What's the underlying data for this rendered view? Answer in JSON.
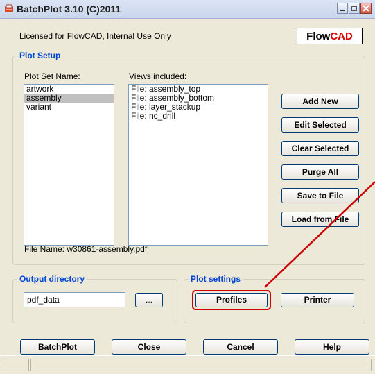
{
  "window": {
    "title": "BatchPlot 3.10 (C)2011"
  },
  "license_text": "Licensed for FlowCAD, Internal Use Only",
  "logo": {
    "part1": "Flow",
    "part2": "CAD",
    "accent": "#e10000"
  },
  "plot_setup": {
    "group_label": "Plot Setup",
    "plot_set_label": "Plot Set Name:",
    "views_label": "Views included:",
    "plot_sets": [
      "artwork",
      "assembly",
      "variant"
    ],
    "selected_plot_set": "assembly",
    "views": [
      "File: assembly_top",
      "File: assembly_bottom",
      "File: layer_stackup",
      "File: nc_drill"
    ],
    "buttons": {
      "add_new": "Add New",
      "edit_selected": "Edit Selected",
      "clear_selected": "Clear Selected",
      "purge_all": "Purge All",
      "save_to_file": "Save to File",
      "load_from_file": "Load from File"
    },
    "file_name": "File Name: w30861-assembly.pdf"
  },
  "output_directory": {
    "group_label": "Output directory",
    "value": "pdf_data",
    "browse_label": "..."
  },
  "plot_settings": {
    "group_label": "Plot settings",
    "profiles_label": "Profiles",
    "printer_label": "Printer"
  },
  "footer_buttons": {
    "batchplot": "BatchPlot",
    "close": "Close",
    "cancel": "Cancel",
    "help": "Help"
  },
  "annotation": {
    "color": "#cc0000"
  }
}
